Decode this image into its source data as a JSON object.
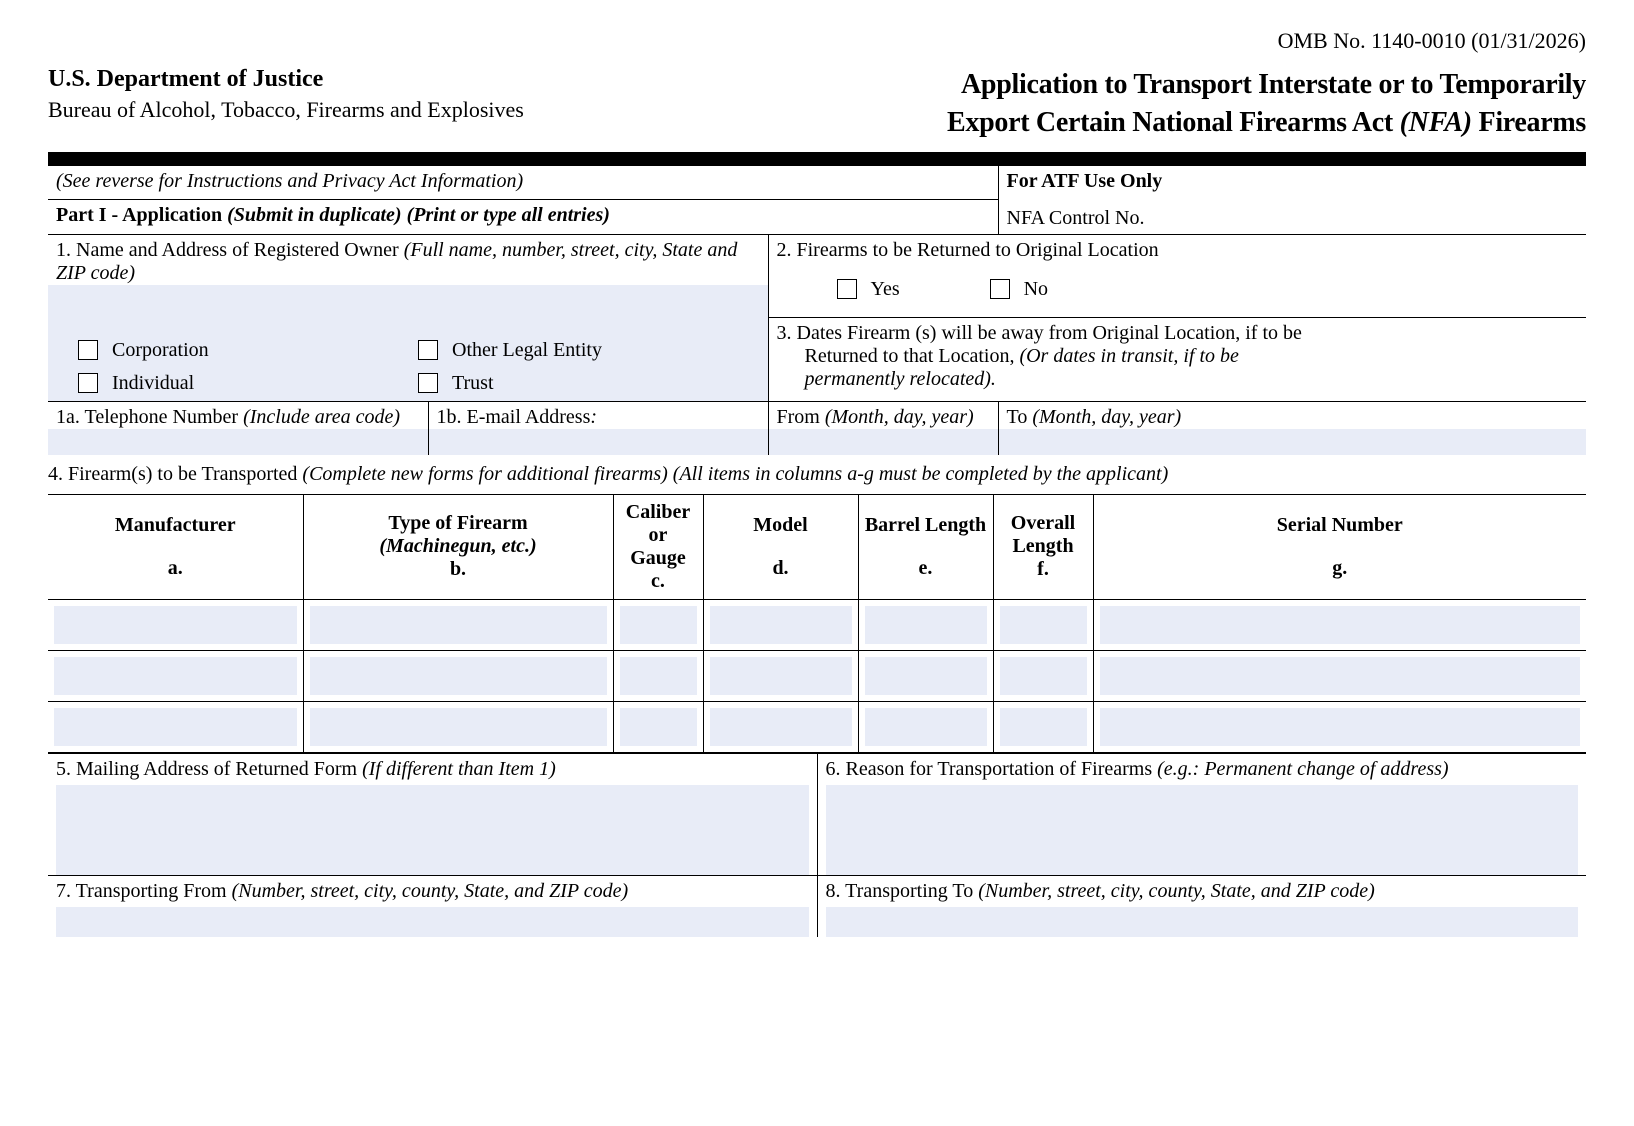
{
  "omb": "OMB No. 1140-0010 (01/31/2026)",
  "dept": "U.S. Department of Justice",
  "bureau": "Bureau of Alcohol, Tobacco, Firearms and Explosives",
  "title_line1": "Application to Transport Interstate or to Temporarily",
  "title_line2_a": "Export Certain National Firearms Act ",
  "title_line2_b": "(NFA)",
  "title_line2_c": " Firearms",
  "see_reverse": "(See reverse for Instructions and Privacy Act Information)",
  "atf_use": "For  ATF Use Only",
  "part1_a": "Part I - Application ",
  "part1_b": "(Submit in duplicate) (Print or type all entries)",
  "nfa_control": "NFA Control No.",
  "q1_a": "1.  Name and Address of Registered Owner ",
  "q1_b": "(Full name, number, street, city, State and ZIP code)",
  "corp": "Corporation",
  "other_entity": "Other Legal Entity",
  "individual": "Individual",
  "trust": "Trust",
  "q2": "2.  Firearms to be Returned to Original Location",
  "yes": "Yes",
  "no": "No",
  "q3_a": "3.   Dates Firearm (s) will be away from Original Location, if to be",
  "q3_b": "Returned to that Location, ",
  "q3_c": "(Or dates in transit, if to be",
  "q3_d": "permanently relocated).",
  "q1a_a": "1a.  Telephone Number  ",
  "q1a_b": "(Include area code)",
  "q1b_a": "1b.  E-mail Address",
  "q1b_b": ":",
  "from_a": "From ",
  "from_b": "(Month, day, year)",
  "to_a": "To  ",
  "to_b": "(Month, day, year)",
  "q4_a": "4.  Firearm(s) to be Transported ",
  "q4_b": "(Complete new forms for additional firearms) (All items in columns a-g must be completed by the applicant)",
  "cols": {
    "a1": "Manufacturer",
    "a2": "a.",
    "b1": "Type of Firearm",
    "b1i": "(Machinegun, etc.)",
    "b2": "b.",
    "c1": "Caliber",
    "c1b": "or",
    "c1c": "Gauge",
    "c2": "c.",
    "d1": "Model",
    "d2": "d.",
    "e1": "Barrel Length",
    "e2": "e.",
    "f1": "Overall",
    "f1b": "Length",
    "f2": "f.",
    "g1": "Serial Number",
    "g2": "g."
  },
  "q5_a": "5.  Mailing Address of Returned Form ",
  "q5_b": "(If different than Item 1)",
  "q6_a": "6.  Reason for Transportation of Firearms ",
  "q6_b": "(e.g.: Permanent change of address)",
  "q7_a": "7.  Transporting From ",
  "q7_b": "(Number, street, city, county, State, and ZIP code)",
  "q8_a": "8.  Transporting To ",
  "q8_b": "(Number, street, city, county, State, and ZIP code)"
}
